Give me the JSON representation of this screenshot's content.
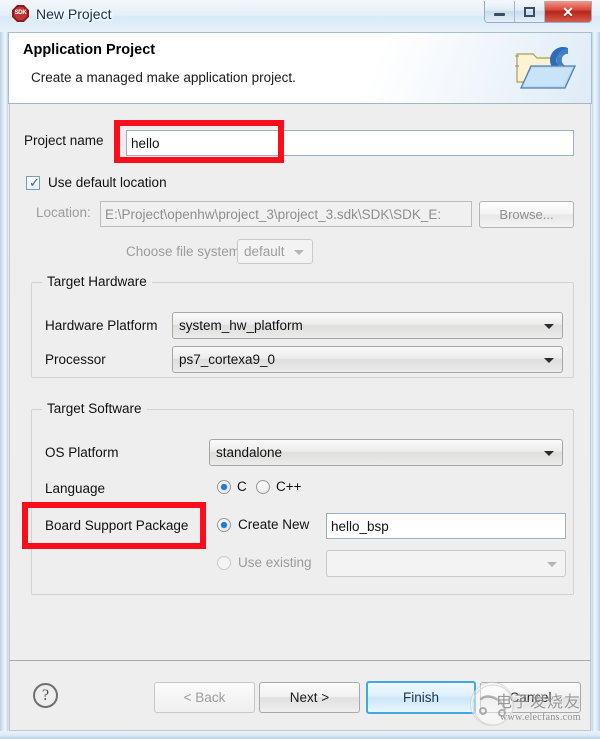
{
  "window": {
    "title": "New Project",
    "app_icon": "sdk-icon",
    "icon_label": "SDK",
    "controls": {
      "minimize": "minimize-icon",
      "maximize": "maximize-icon",
      "close": "✕"
    }
  },
  "header": {
    "title": "Application Project",
    "subtitle": "Create a managed make application project.",
    "icon": "c-project-folder-icon"
  },
  "form": {
    "project_name_label": "Project name",
    "project_name_value": "hello",
    "use_default_location_label": "Use default location",
    "use_default_location_checked": true,
    "location_label": "Location:",
    "location_value": "E:\\Project\\openhw\\project_3\\project_3.sdk\\SDK\\SDK_E:",
    "browse_label": "Browse...",
    "choose_file_system_label": "Choose file system:",
    "choose_file_system_value": "default"
  },
  "target_hardware": {
    "group_label": "Target Hardware",
    "hardware_platform_label": "Hardware Platform",
    "hardware_platform_value": "system_hw_platform",
    "processor_label": "Processor",
    "processor_value": "ps7_cortexa9_0"
  },
  "target_software": {
    "group_label": "Target Software",
    "os_platform_label": "OS Platform",
    "os_platform_value": "standalone",
    "language_label": "Language",
    "language_options": [
      {
        "label": "C",
        "selected": true
      },
      {
        "label": "C++",
        "selected": false
      }
    ],
    "bsp_label": "Board Support Package",
    "bsp_create_new_label": "Create New",
    "bsp_create_new_selected": true,
    "bsp_name_value": "hello_bsp",
    "bsp_use_existing_label": "Use existing",
    "bsp_use_existing_selected": false,
    "bsp_use_existing_value": ""
  },
  "footer": {
    "help_label": "?",
    "back_label": "< Back",
    "next_label": "Next >",
    "finish_label": "Finish",
    "cancel_label": "Cancel"
  },
  "watermark": {
    "cn_text": "电子发烧友",
    "url_text": "www.elecfans.com"
  },
  "annotations": {
    "color": "#fc0d1b",
    "boxes": [
      {
        "name": "project-name-highlight"
      },
      {
        "name": "board-support-package-highlight"
      }
    ]
  }
}
